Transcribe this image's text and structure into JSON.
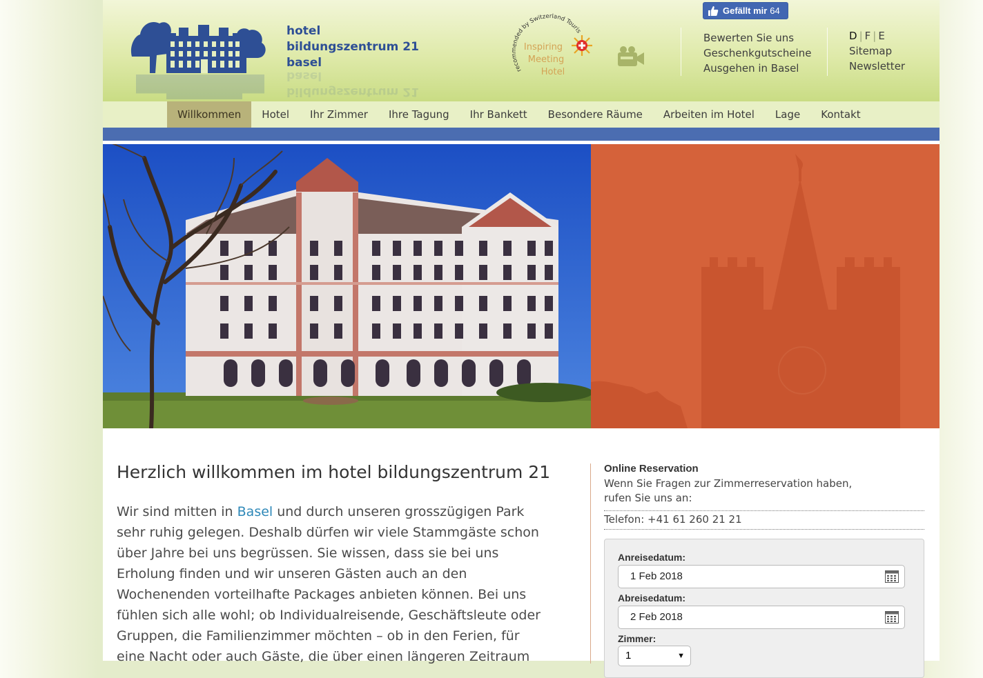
{
  "header": {
    "logo_lines": [
      "hotel",
      "bildungszentrum 21",
      "basel"
    ],
    "badge_arc_text": "recommended by Switzerland Tourism",
    "badge_lines": [
      "Inspiring",
      "Meeting",
      "Hotel"
    ],
    "facebook": {
      "label": "Gefällt mir",
      "count": "64"
    },
    "links": [
      "Bewerten Sie uns",
      "Geschenkgutscheine",
      "Ausgehen in Basel"
    ],
    "languages": [
      "D",
      "F",
      "E"
    ],
    "secondary_links": [
      "Sitemap",
      "Newsletter"
    ]
  },
  "nav": {
    "items": [
      "Willkommen",
      "Hotel",
      "Ihr Zimmer",
      "Ihre Tagung",
      "Ihr Bankett",
      "Besondere Räume",
      "Arbeiten im Hotel",
      "Lage",
      "Kontakt"
    ]
  },
  "main": {
    "title": "Herzlich willkommen im hotel bildungszentrum 21",
    "intro_pre": "Wir sind mitten in ",
    "intro_link": "Basel",
    "intro_post": " und durch unseren grosszügigen Park",
    "lines": [
      "sehr ruhig gelegen. Deshalb dürfen wir viele Stammgäste schon",
      "über Jahre bei uns begrüssen. Sie wissen, dass sie bei uns",
      "Erholung finden und wir unseren Gästen auch an den",
      "Wochenenden vorteilhafte Packages anbieten können. Bei uns",
      "fühlen sich alle wohl; ob Individualreisende, Geschäftsleute oder",
      "Gruppen, die Familienzimmer möchten – ob in den Ferien, für",
      "eine Nacht oder auch Gäste, die über einen längeren Zeitraum"
    ]
  },
  "reservation": {
    "title": "Online Reservation",
    "text_lines": [
      "Wenn Sie Fragen zur Zimmerreservation haben,",
      "rufen Sie uns an:"
    ],
    "phone": "Telefon: +41 61 260 21 21",
    "arrival_label": "Anreisedatum:",
    "arrival_value": "1 Feb 2018",
    "departure_label": "Abreisedatum:",
    "departure_value": "2 Feb 2018",
    "rooms_label": "Zimmer:",
    "rooms_value": "1"
  },
  "colors": {
    "brand_blue": "#2e4f95",
    "nav_bar_blue": "#4b6db1",
    "nav_active": "#b8b27a",
    "hero_orange": "#d5623a",
    "facebook_blue": "#4267b2",
    "link_blue": "#2e88b8"
  },
  "icons": [
    "building-logo",
    "camera-icon",
    "facebook-thumb-icon",
    "calendar-icon",
    "dropdown-arrow-icon",
    "swiss-sun-icon"
  ]
}
